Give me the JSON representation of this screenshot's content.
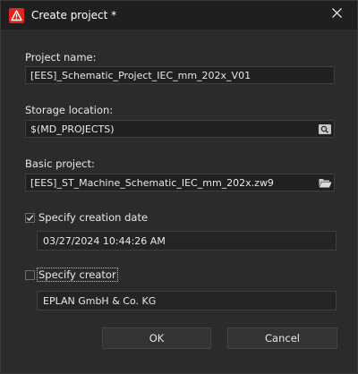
{
  "window": {
    "title": "Create project *",
    "app_icon": "eplan-warning-triangle-icon",
    "close_icon": "close-icon",
    "accent": "#e2231a"
  },
  "project_name": {
    "label": "Project name:",
    "value": "[EES]_Schematic_Project_IEC_mm_202x_V01"
  },
  "storage_location": {
    "label": "Storage location:",
    "value": "$(MD_PROJECTS)",
    "browse_icon": "search-icon"
  },
  "basic_project": {
    "label": "Basic project:",
    "value": "[EES]_ST_Machine_Schematic_IEC_mm_202x.zw9",
    "browse_icon": "folder-open-icon"
  },
  "creation_date": {
    "label": "Specify creation date",
    "checked": true,
    "value": "03/27/2024 10:44:26 AM"
  },
  "creator": {
    "label": "Specify creator",
    "checked": false,
    "value": "EPLAN GmbH & Co. KG"
  },
  "buttons": {
    "ok": "OK",
    "cancel": "Cancel"
  }
}
